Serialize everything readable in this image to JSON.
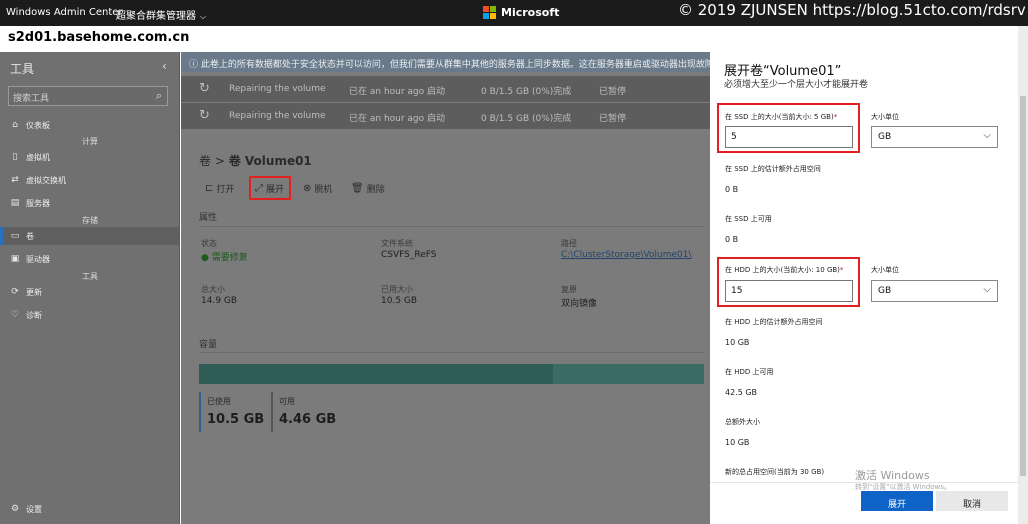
{
  "topbar": {
    "app_name": "Windows Admin Center",
    "context": "超聚合群集管理器",
    "brand": "Microsoft",
    "watermark": "© 2019 ZJUNSEN https://blog.51cto.com/rdsrv"
  },
  "server_name": "s2d01.basehome.com.cn",
  "nav": {
    "title": "工具",
    "search_placeholder": "搜索工具",
    "items": [
      {
        "label": "仪表板",
        "icon": "dashboard-icon"
      },
      {
        "label": "计算",
        "group": true
      },
      {
        "label": "虚拟机",
        "icon": "vm-icon"
      },
      {
        "label": "虚拟交换机",
        "icon": "switch-icon"
      },
      {
        "label": "服务器",
        "icon": "server-icon"
      },
      {
        "label": "存储",
        "group": true
      },
      {
        "label": "卷",
        "icon": "volume-icon",
        "selected": true
      },
      {
        "label": "驱动器",
        "icon": "drive-icon"
      },
      {
        "label": "工具",
        "group": true
      },
      {
        "label": "更新",
        "icon": "update-icon"
      },
      {
        "label": "诊断",
        "icon": "diagnostics-icon"
      },
      {
        "label": "设置",
        "icon": "settings-icon"
      }
    ]
  },
  "main": {
    "info": "此卷上的所有数据都处于安全状态并可以访问，但我们需要从群集中其他的服务器上同步数据。这在服务器重启或驱动器出现故障",
    "jobs": [
      {
        "name": "Repairing the volume",
        "started": "已在 an hour ago 启动",
        "progress": "0 B/1.5 GB (0%)完成",
        "state": "已暂停"
      },
      {
        "name": "Repairing the volume",
        "started": "已在 an hour ago 启动",
        "progress": "0 B/1.5 GB (0%)完成",
        "state": "已暂停"
      }
    ],
    "breadcrumb_root": "卷",
    "breadcrumb_sep": ">",
    "breadcrumb_current": "卷 Volume01",
    "toolbar": {
      "open": "打开",
      "expand": "展开",
      "offline": "脱机",
      "delete": "删除"
    },
    "props_title": "属性",
    "props": {
      "status_label": "状态",
      "status_value": "需要修复",
      "fs_label": "文件系统",
      "fs_value": "CSVFS_ReFS",
      "path_label": "路径",
      "path_value": "C:\\ClusterStorage\\Volume01\\",
      "total_label": "总大小",
      "total_value": "14.9 GB",
      "used_label": "已用大小",
      "used_value": "10.5 GB",
      "resil_label": "复原",
      "resil_value": "双向镜像"
    },
    "capacity_title": "容量",
    "capacity": {
      "used_label": "已使用",
      "used_value": "10.5 GB",
      "avail_label": "可用",
      "avail_value": "4.46 GB",
      "used_fraction": 0.7
    }
  },
  "panel": {
    "title": "展开卷“Volume01”",
    "subtitle": "必须增大至少一个层大小才能展开卷",
    "ssd_label": "在 SSD 上的大小(当前大小: 5 GB)",
    "required_mark": "*",
    "ssd_value": "5",
    "unit_label": "大小单位",
    "ssd_unit": "GB",
    "ssd_est_label": "在 SSD 上的估计额外占用空间",
    "ssd_est_value": "0 B",
    "ssd_avail_label": "在 SSD 上可用",
    "ssd_avail_value": "0 B",
    "hdd_label": "在 HDD 上的大小(当前大小: 10 GB)",
    "hdd_value": "15",
    "hdd_unit": "GB",
    "hdd_est_label": "在 HDD 上的估计额外占用空间",
    "hdd_est_value": "10 GB",
    "hdd_avail_label": "在 HDD 上可用",
    "hdd_avail_value": "42.5 GB",
    "total_extra_label": "总额外大小",
    "total_extra_value": "10 GB",
    "new_total_label": "新的总占用空间(当前为 30 GB)",
    "activate_title": "激活 Windows",
    "activate_sub": "转到\"设置\"以激活 Windows。",
    "expand_button": "展开",
    "cancel_button": "取消"
  },
  "colors": {
    "accent": "#0f63c7",
    "highlight": "#e2201f",
    "topbar": "#1b1b1b"
  }
}
